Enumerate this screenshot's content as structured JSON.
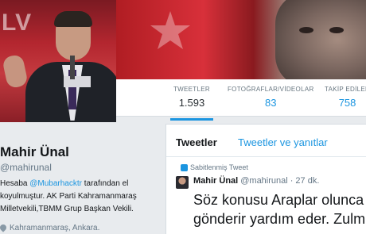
{
  "profile": {
    "name": "Mahir Ünal",
    "handle": "@mahirunal",
    "bio_prefix": "Hesaba ",
    "bio_mention": "@Mubarhacktr",
    "bio_line1_suffix": " tarafından el",
    "bio_line2": "koyulmuştur. AK Parti Kahramanmaraş",
    "bio_line3": "Milletvekili,TBMM Grup Başkan Vekili.",
    "location": "Kahramanmaraş, Ankara."
  },
  "stats": [
    {
      "label": "TWEETLER",
      "value": "1.593"
    },
    {
      "label": "FOTOĞRAFLAR/VİDEOLAR",
      "value": "83"
    },
    {
      "label": "TAKİP EDİLEN",
      "value": "758"
    }
  ],
  "tabs": {
    "tweets": "Tweetler",
    "replies": "Tweetler ve yanıtlar"
  },
  "pinned_tweet": {
    "label": "Sabitlenmiş Tweet",
    "author_name": "Mahir Ünal",
    "author_handle": "@mahirunal",
    "time": "· 27 dk.",
    "text_line1": "Söz konusu Araplar olunca",
    "text_line2": "gönderir yardım eder. Zulm"
  },
  "colors": {
    "accent": "#1b95e0",
    "text": "#14171a",
    "muted": "#657786"
  }
}
